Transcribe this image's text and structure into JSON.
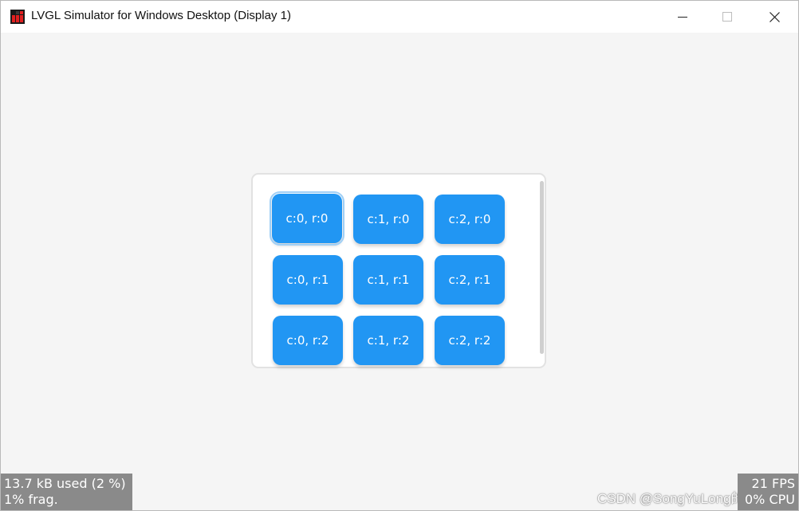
{
  "window": {
    "title": "LVGL Simulator for Windows Desktop (Display 1)",
    "icon": "lvgl-app-icon",
    "controls": [
      "minimize-icon",
      "maximize-icon",
      "close-icon"
    ]
  },
  "grid": {
    "columns": 3,
    "rows": 3,
    "focused_cell": "c:0, r:0",
    "cells": [
      {
        "label": "c:0, r:0"
      },
      {
        "label": "c:1, r:0"
      },
      {
        "label": "c:2, r:0"
      },
      {
        "label": "c:0, r:1"
      },
      {
        "label": "c:1, r:1"
      },
      {
        "label": "c:2, r:1"
      },
      {
        "label": "c:0, r:2"
      },
      {
        "label": "c:1, r:2"
      },
      {
        "label": "c:2, r:2"
      }
    ]
  },
  "mem_monitor": {
    "line1": "13.7 kB used (2 %)",
    "line2": "1% frag."
  },
  "perf_monitor": {
    "line1": "21 FPS",
    "line2": "0% CPU"
  },
  "watermark": {
    "text": "CSDN @SongYuLong的博客"
  },
  "colors": {
    "button": "#2196f3",
    "monitor_bg": "#8a8a8a",
    "background": "#f5f5f5"
  }
}
